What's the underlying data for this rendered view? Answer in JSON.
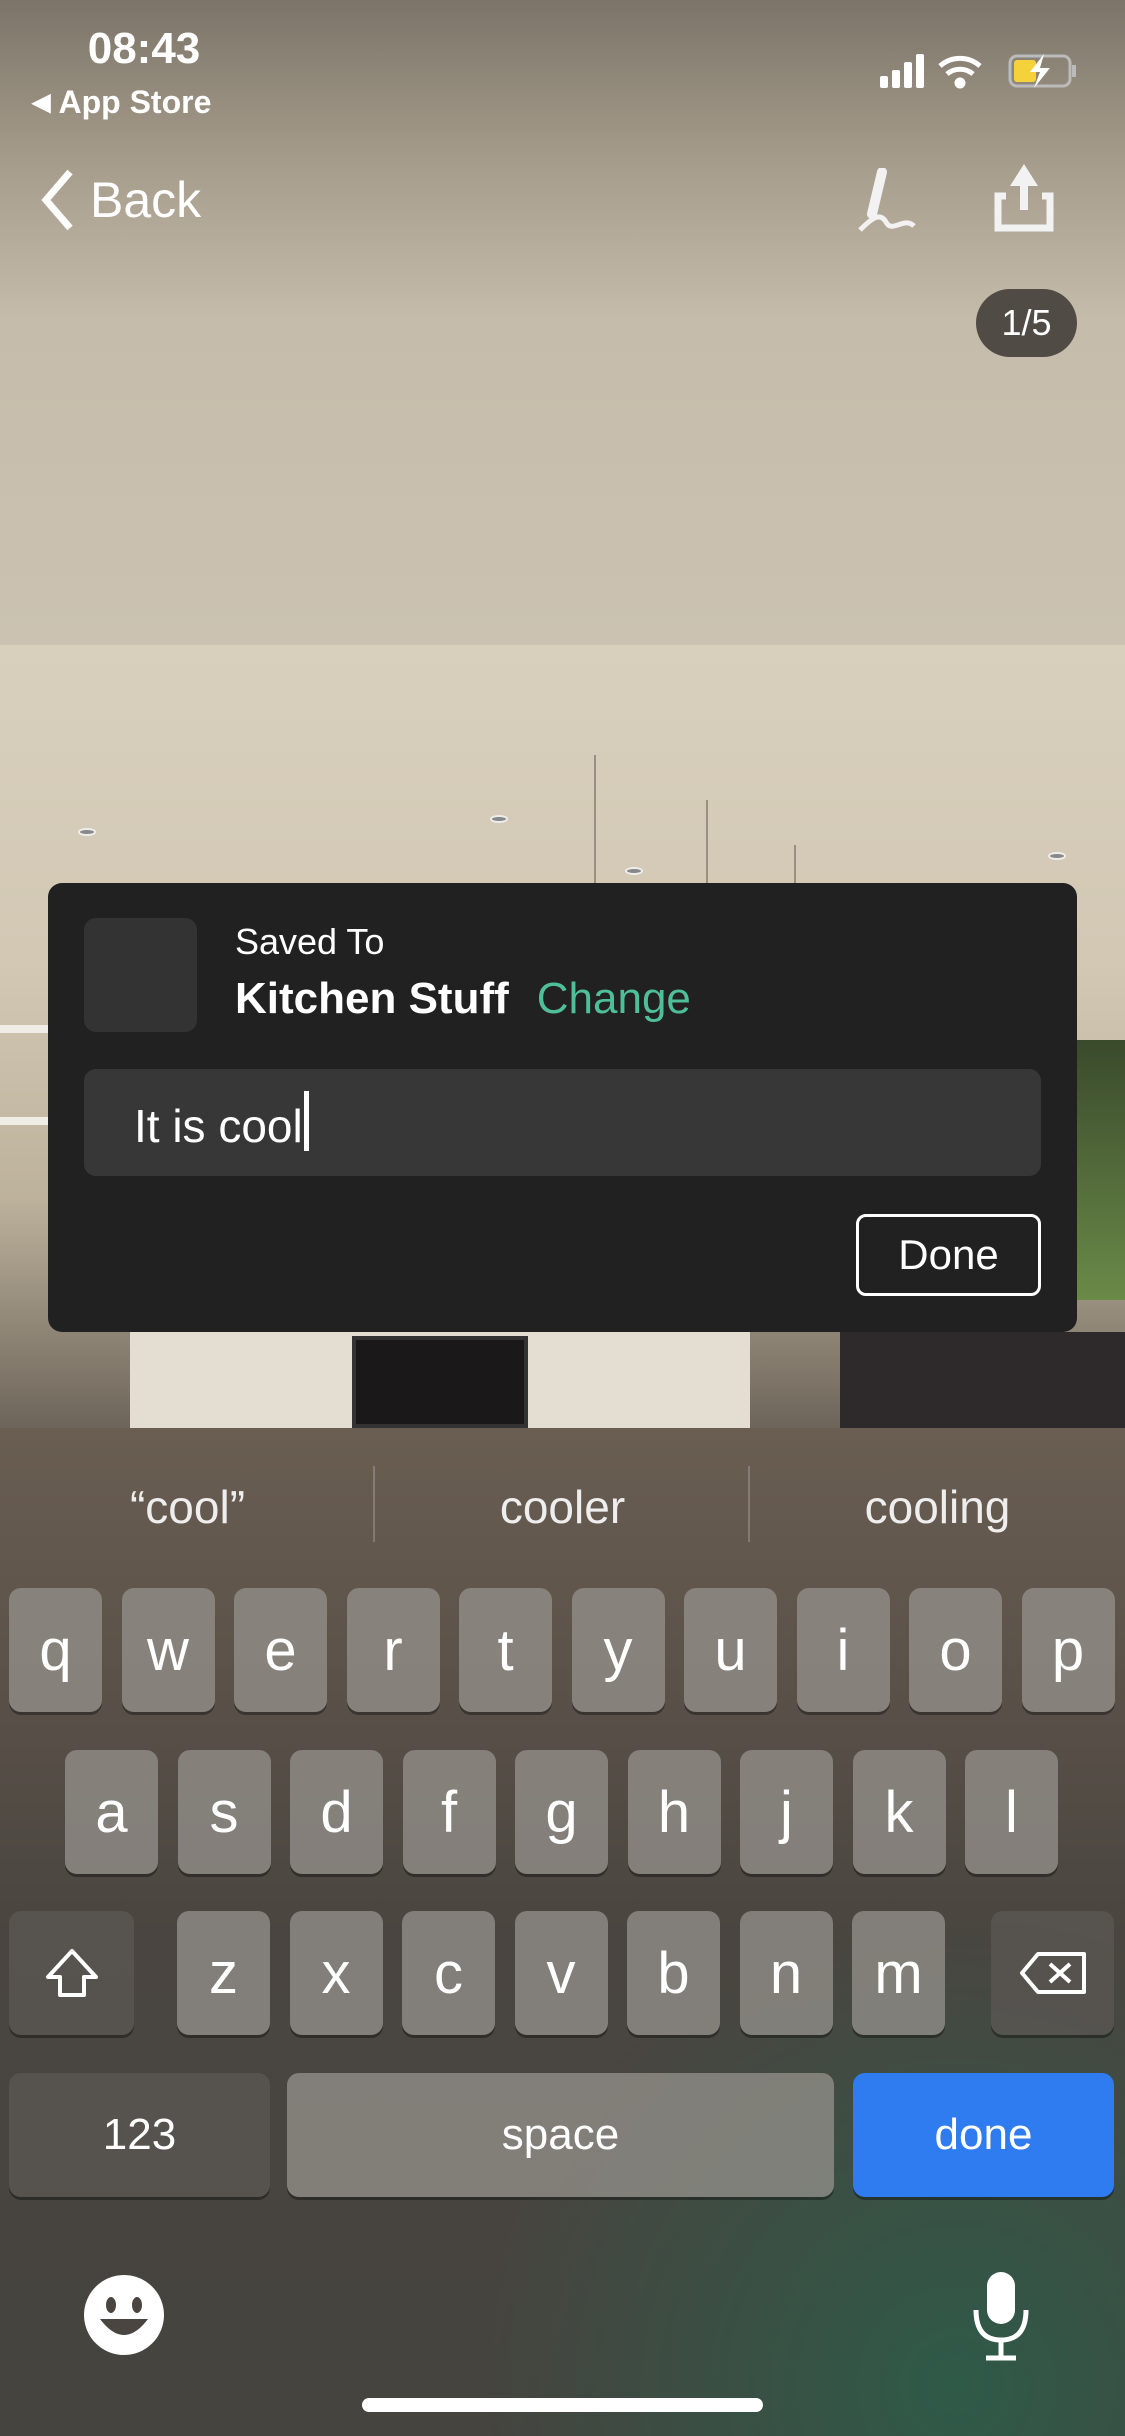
{
  "status_bar": {
    "time": "08:43",
    "back_app": "App Store",
    "battery_color": "#f5d13b"
  },
  "nav": {
    "back_label": "Back",
    "edit_icon": "pen-signature-icon",
    "share_icon": "share-icon"
  },
  "photo": {
    "counter": "1/5"
  },
  "save_card": {
    "saved_to_label": "Saved To",
    "album_name": "Kitchen Stuff",
    "change_label": "Change",
    "change_color": "#4fbf9a",
    "note_value": "It is cool",
    "done_label": "Done"
  },
  "keyboard": {
    "suggestions": [
      "“cool”",
      "cooler",
      "cooling"
    ],
    "row1": [
      "q",
      "w",
      "e",
      "r",
      "t",
      "y",
      "u",
      "i",
      "o",
      "p"
    ],
    "row2": [
      "a",
      "s",
      "d",
      "f",
      "g",
      "h",
      "j",
      "k",
      "l"
    ],
    "row3": [
      "z",
      "x",
      "c",
      "v",
      "b",
      "n",
      "m"
    ],
    "numbers_label": "123",
    "space_label": "space",
    "done_label": "done",
    "done_color": "#2f7bf0"
  }
}
